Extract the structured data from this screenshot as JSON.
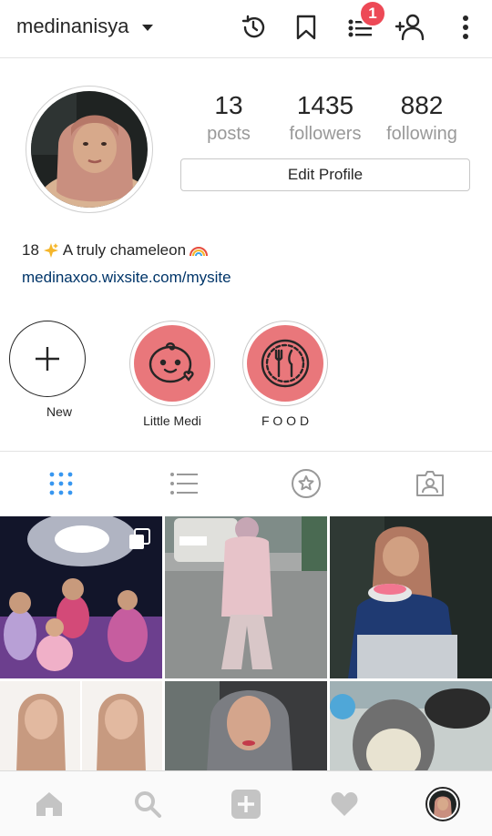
{
  "header": {
    "username": "medinanisya",
    "notification_count": "1"
  },
  "profile": {
    "stats": [
      {
        "value": "13",
        "label": "posts"
      },
      {
        "value": "1435",
        "label": "followers"
      },
      {
        "value": "882",
        "label": "following"
      }
    ],
    "edit_profile_label": "Edit Profile",
    "bio_prefix": "18",
    "bio_text": "A truly chameleon",
    "website": "medinaxoo.wixsite.com/mysite"
  },
  "highlights": [
    {
      "label": "New"
    },
    {
      "label": "Little Medi"
    },
    {
      "label": "F O O D"
    }
  ],
  "colors": {
    "accent_blue": "#3897f0",
    "link_blue": "#003569",
    "badge_red": "#ed4956",
    "highlight_pink": "#e9777b"
  },
  "tabs": [
    {
      "name": "grid-view",
      "active": true
    },
    {
      "name": "list-view",
      "active": false
    },
    {
      "name": "saved-star",
      "active": false
    },
    {
      "name": "tagged-photos",
      "active": false
    }
  ]
}
